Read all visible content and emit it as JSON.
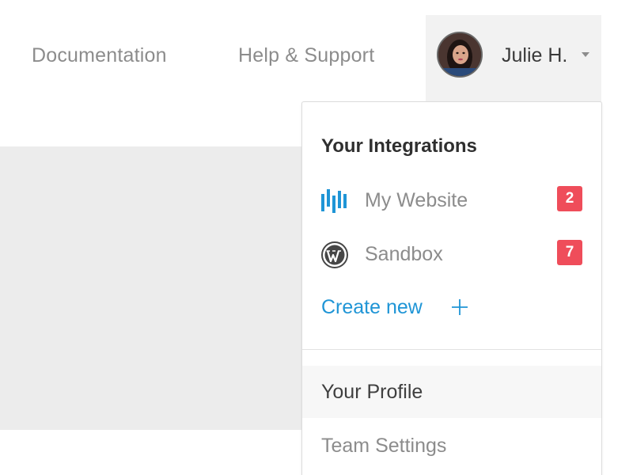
{
  "nav": {
    "documentation": "Documentation",
    "help_support": "Help & Support"
  },
  "user": {
    "name": "Julie H."
  },
  "dropdown": {
    "heading": "Your Integrations",
    "integrations": [
      {
        "label": "My Website",
        "icon": "bar-chart-icon",
        "count": "2"
      },
      {
        "label": "Sandbox",
        "icon": "wordpress-icon",
        "count": "7"
      }
    ],
    "create_new": "Create new",
    "menu": [
      {
        "label": "Your Profile"
      },
      {
        "label": "Team Settings"
      }
    ]
  },
  "colors": {
    "accent": "#1f95d6",
    "badge": "#ef4d5a",
    "panel_gray": "#ececec"
  }
}
